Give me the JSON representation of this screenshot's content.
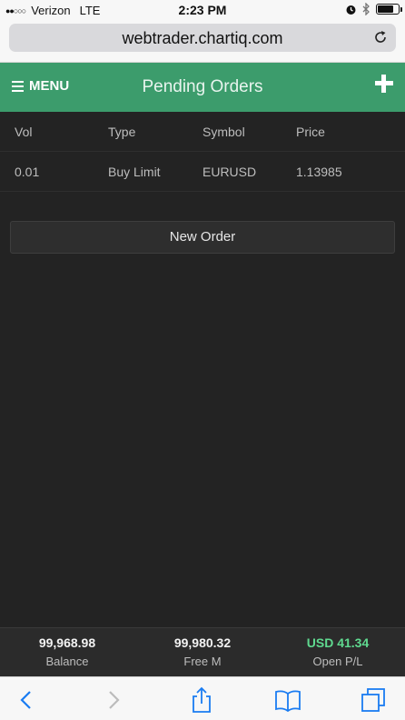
{
  "status_bar": {
    "carrier": "Verizon",
    "network": "LTE",
    "time": "2:23 PM"
  },
  "browser": {
    "url": "webtrader.chartiq.com"
  },
  "header": {
    "menu_label": "MENU",
    "title": "Pending Orders"
  },
  "orders": {
    "columns": [
      "Vol",
      "Type",
      "Symbol",
      "Price"
    ],
    "rows": [
      {
        "vol": "0.01",
        "type": "Buy Limit",
        "symbol": "EURUSD",
        "price": "1.13985"
      }
    ]
  },
  "actions": {
    "new_order_label": "New Order"
  },
  "summary": {
    "balance_value": "99,968.98",
    "balance_label": "Balance",
    "free_margin_value": "99,980.32",
    "free_margin_label": "Free M",
    "open_pl_value": "USD 41.34",
    "open_pl_label": "Open P/L"
  },
  "colors": {
    "accent": "#3c9c6c",
    "positive": "#5fd98f",
    "ios_blue": "#1a7cf2"
  },
  "icons": [
    "menu-icon",
    "plus-icon",
    "reload-icon",
    "back-icon",
    "forward-icon",
    "share-icon",
    "bookmarks-icon",
    "tabs-icon",
    "alarm-icon",
    "bluetooth-icon",
    "battery-icon"
  ]
}
